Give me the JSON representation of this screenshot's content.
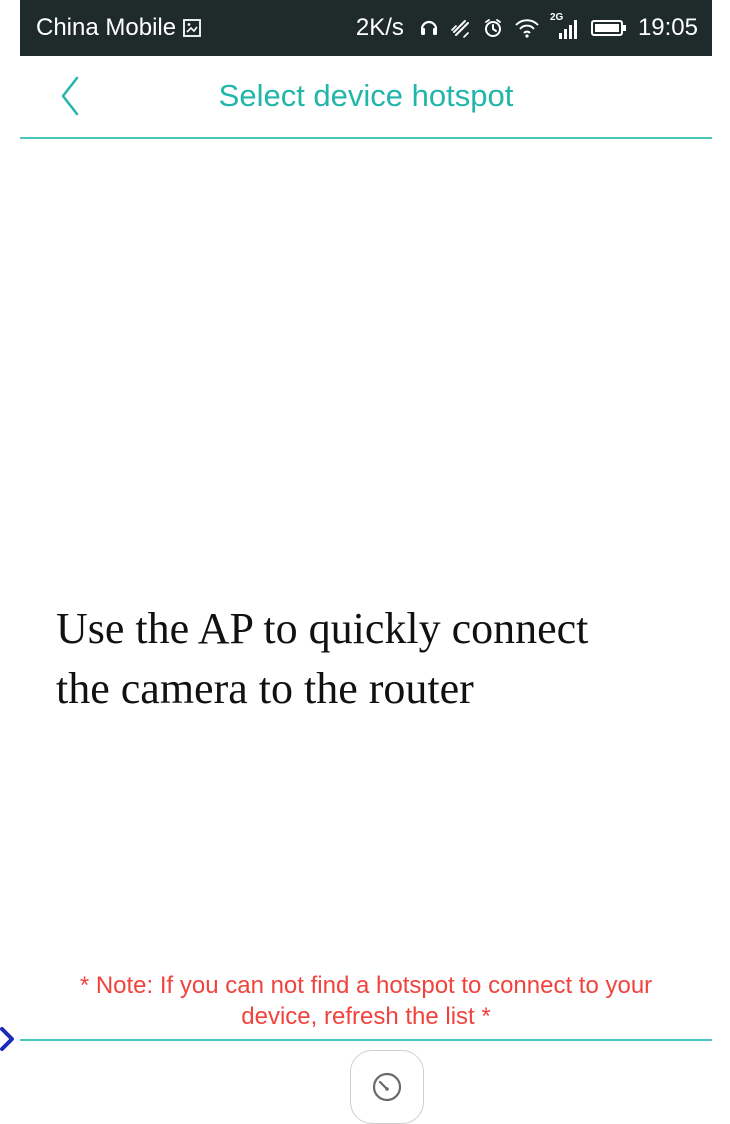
{
  "status_bar": {
    "carrier": "China Mobile",
    "speed": "2K/s",
    "network_badge": "2G",
    "time": "19:05",
    "icons": [
      "image-icon",
      "headphones-icon",
      "vibrate-icon",
      "alarm-icon",
      "wifi-icon",
      "signal-icon",
      "battery-icon"
    ]
  },
  "header": {
    "back_icon": "back-arrow-icon",
    "title": "Select device hotspot"
  },
  "main": {
    "line1": "Use the AP to quickly connect",
    "line2": "the camera to the router"
  },
  "footer": {
    "note_line1": "* Note: If you can not find a hotspot to connect to your",
    "note_line2": "device, refresh the list *",
    "refresh_icon": "refresh-icon"
  },
  "colors": {
    "accent": "#22b6aa",
    "note": "#f1433d",
    "status_bar": "#1f2a2a",
    "divider": "#49c6bc"
  }
}
